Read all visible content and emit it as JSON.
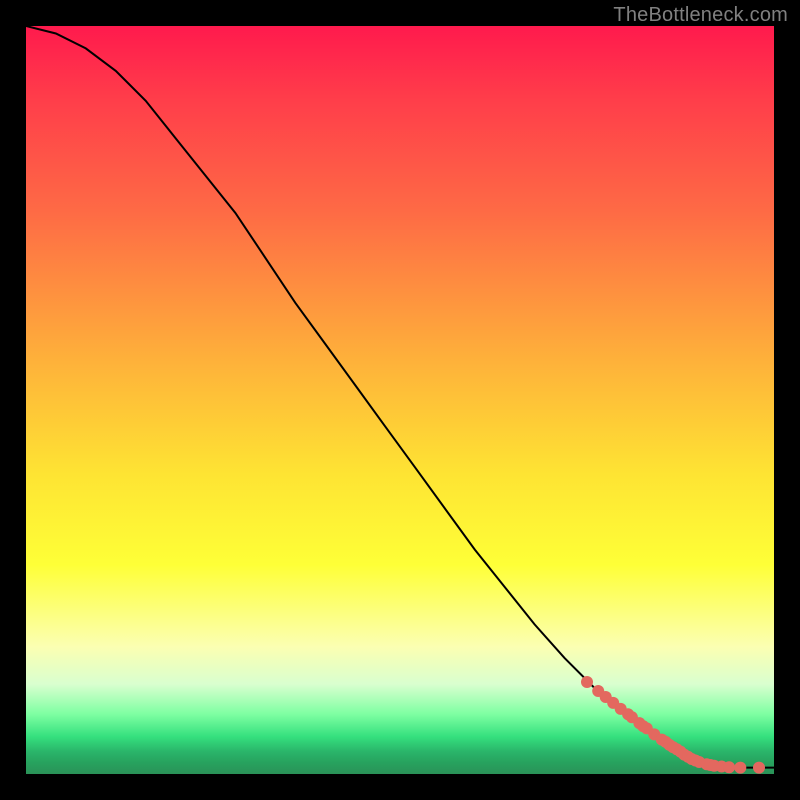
{
  "watermark": "TheBottleneck.com",
  "colors": {
    "dot": "#e3685f",
    "curve": "#000000",
    "frame": "#000000"
  },
  "chart_data": {
    "type": "line",
    "title": "",
    "xlabel": "",
    "ylabel": "",
    "xlim": [
      0,
      100
    ],
    "ylim": [
      0,
      100
    ],
    "grid": false,
    "legend": false,
    "series": [
      {
        "name": "curve",
        "kind": "line",
        "x": [
          0,
          4,
          8,
          12,
          16,
          20,
          24,
          28,
          32,
          36,
          40,
          44,
          48,
          52,
          56,
          60,
          64,
          68,
          72,
          76,
          80,
          84,
          88,
          90,
          92,
          94,
          96,
          98,
          100
        ],
        "y": [
          100,
          99,
          97,
          94,
          90,
          85,
          80,
          75,
          69,
          63,
          57.5,
          52,
          46.5,
          41,
          35.5,
          30,
          25,
          20,
          15.5,
          11.5,
          8,
          5,
          2.6,
          1.6,
          1.1,
          0.9,
          0.85,
          0.85,
          0.85
        ]
      },
      {
        "name": "highlighted-points",
        "kind": "scatter",
        "x": [
          75,
          76.5,
          77.5,
          78.5,
          79.5,
          80.5,
          81,
          82,
          82.5,
          83,
          84,
          85,
          85.5,
          86,
          86.5,
          87,
          87.5,
          88,
          88.5,
          89,
          89.5,
          90,
          91,
          91.5,
          92,
          93,
          94,
          95.5,
          98
        ],
        "y": [
          12.3,
          11.1,
          10.3,
          9.5,
          8.7,
          8.0,
          7.6,
          6.8,
          6.4,
          6.1,
          5.3,
          4.6,
          4.3,
          3.9,
          3.6,
          3.3,
          3.0,
          2.6,
          2.3,
          2.0,
          1.8,
          1.6,
          1.3,
          1.2,
          1.1,
          1.0,
          0.9,
          0.85,
          0.85
        ]
      }
    ]
  }
}
